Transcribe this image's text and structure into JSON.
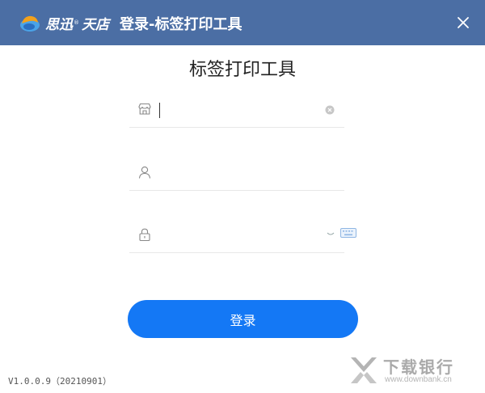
{
  "titlebar": {
    "logo_text": "思迅",
    "logo_reg": "®",
    "logo_text2": "天店",
    "window_title": "登录-标签打印工具",
    "close_icon": "close-icon",
    "background": "#4b6ea4"
  },
  "heading": "标签打印工具",
  "fields": {
    "store": {
      "icon": "store-icon",
      "value": "",
      "placeholder": "",
      "clear_icon": "clear-icon"
    },
    "user": {
      "icon": "user-icon",
      "value": "",
      "placeholder": ""
    },
    "password": {
      "icon": "lock-icon",
      "value": "",
      "placeholder": "",
      "toggle_icon": "eye-closed-icon",
      "keyboard_icon": "keyboard-icon"
    }
  },
  "login_button": {
    "label": "登录",
    "color": "#1478f5"
  },
  "footer": {
    "version": "V1.0.0.9（20210901）"
  },
  "watermark": {
    "title": "下载银行",
    "url": "www.downbank.cn"
  }
}
